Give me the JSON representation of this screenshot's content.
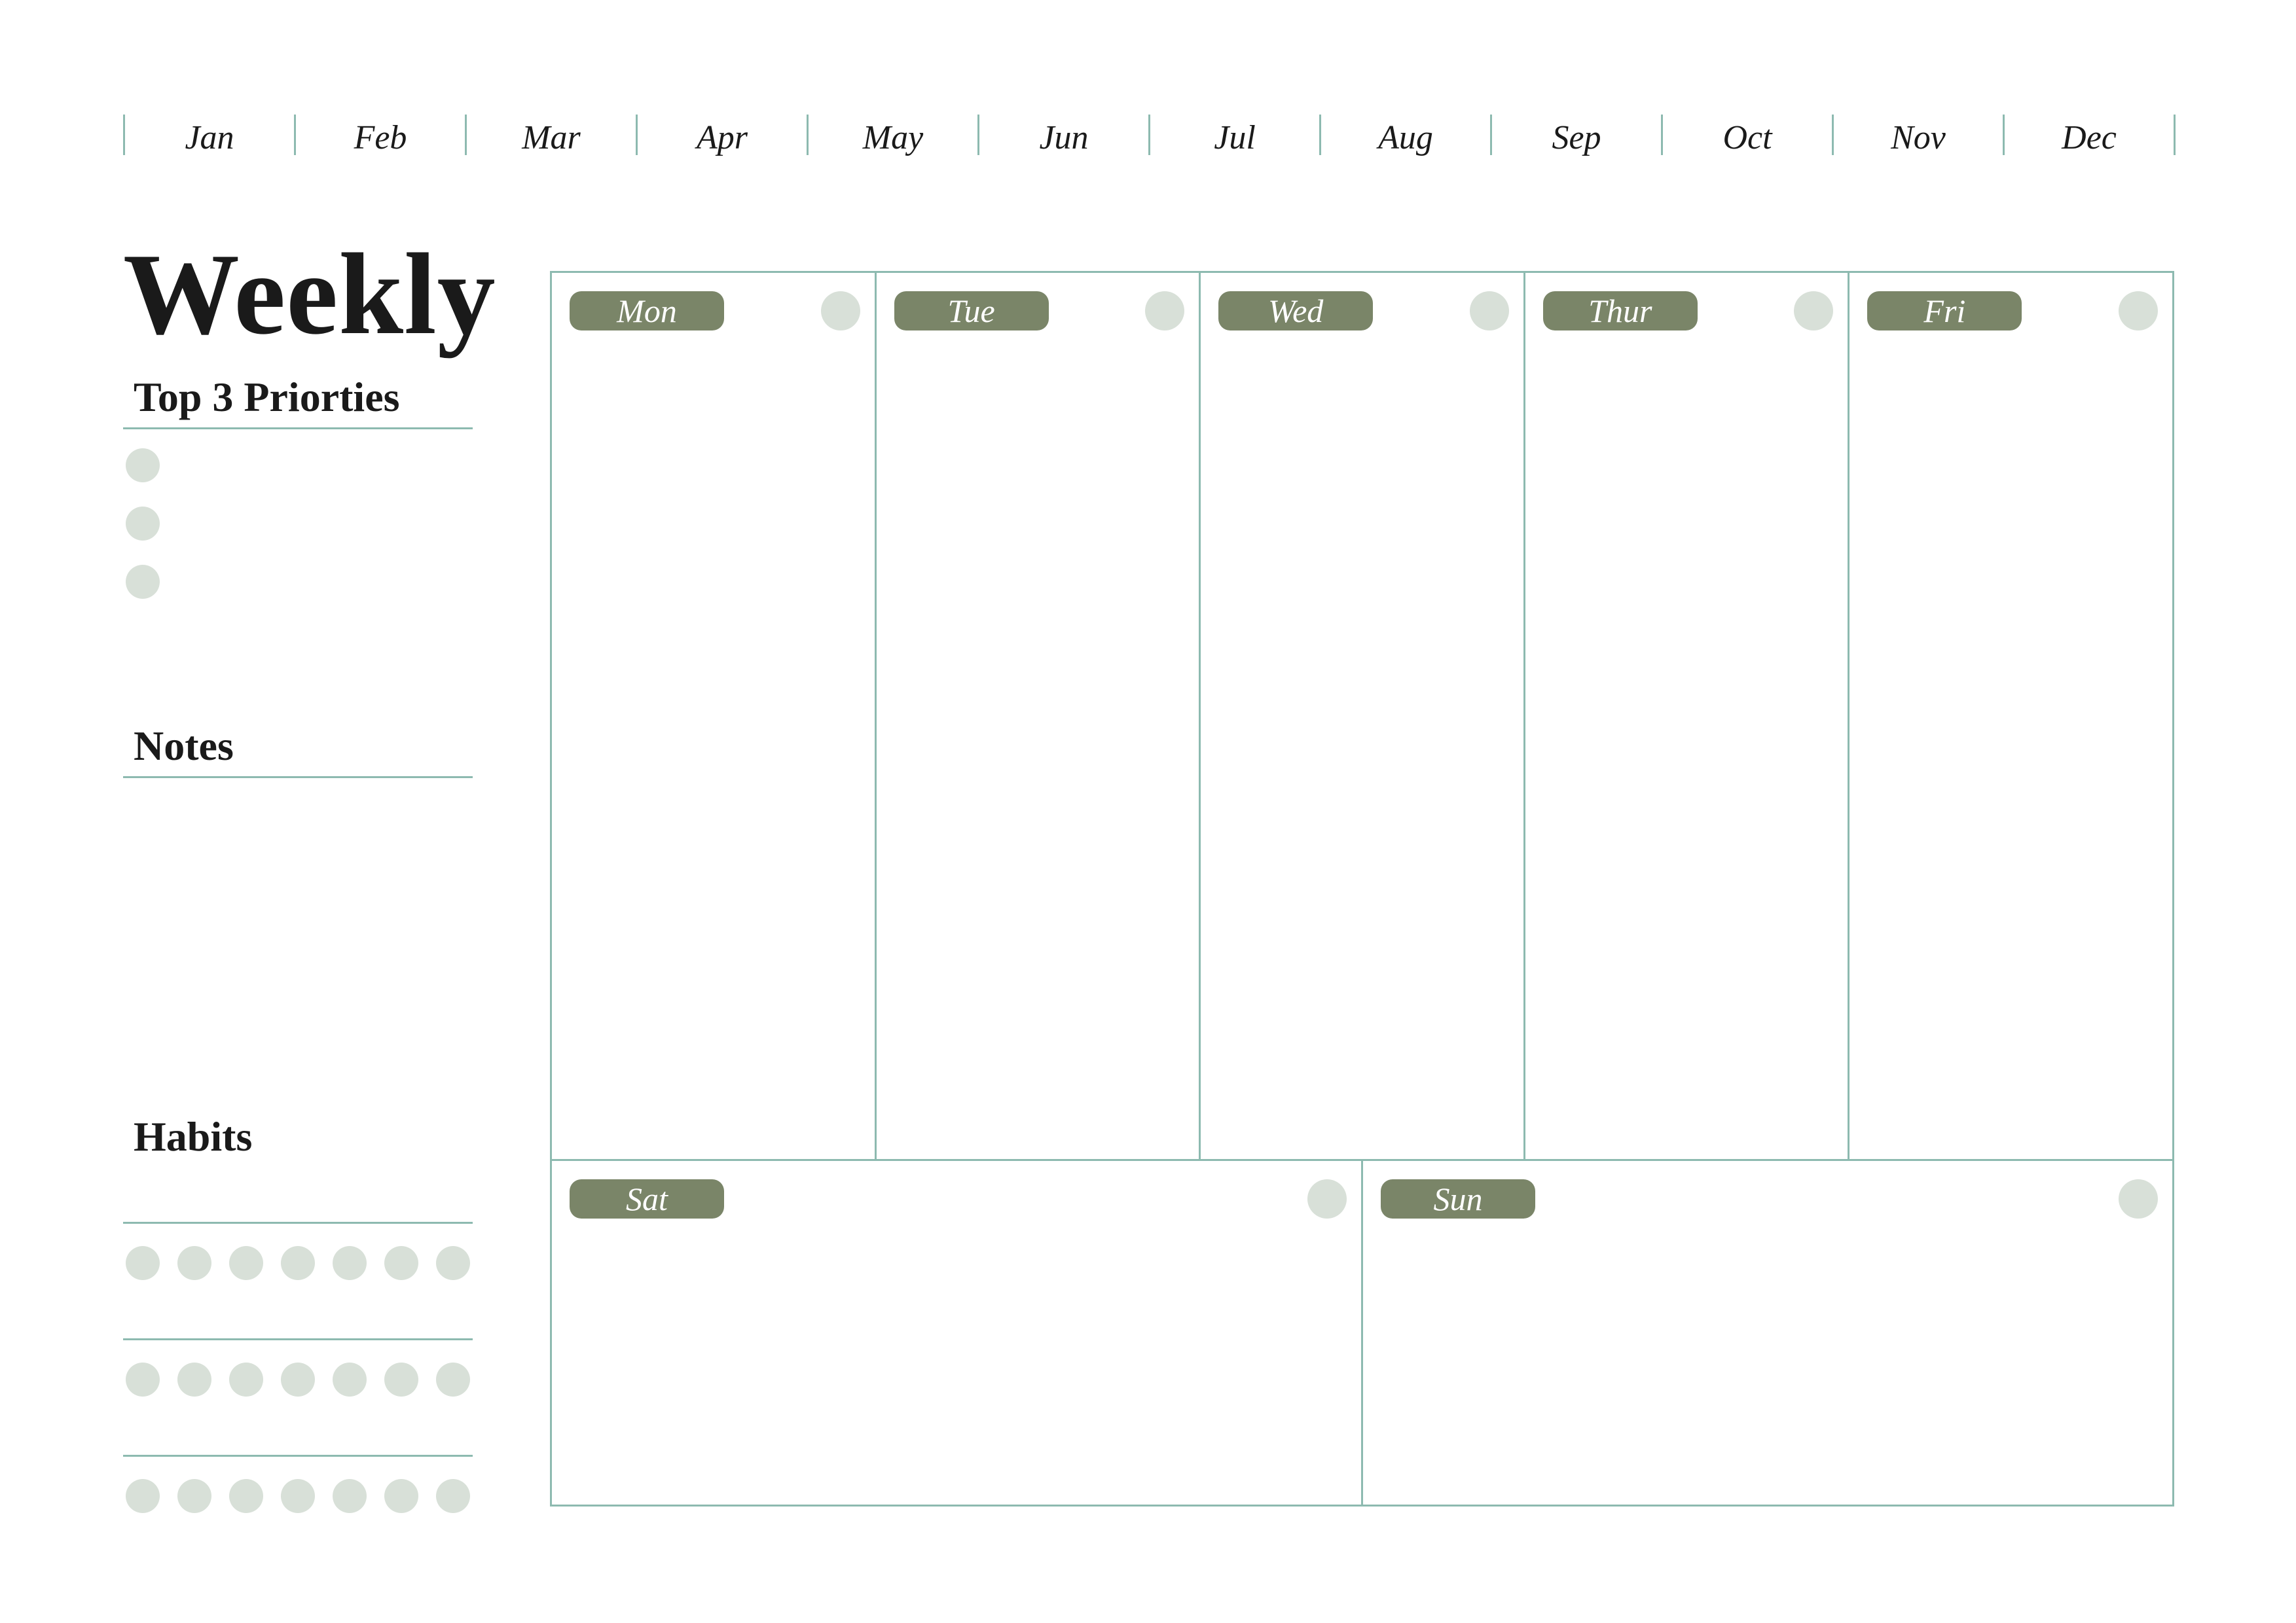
{
  "months": [
    "Jan",
    "Feb",
    "Mar",
    "Apr",
    "May",
    "Jun",
    "Jul",
    "Aug",
    "Sep",
    "Oct",
    "Nov",
    "Dec"
  ],
  "sidebar": {
    "title": "Weekly",
    "priorities_heading": "Top 3 Priorties",
    "notes_heading": "Notes",
    "habits_heading": "Habits"
  },
  "days": {
    "mon": "Mon",
    "tue": "Tue",
    "wed": "Wed",
    "thu": "Thur",
    "fri": "Fri",
    "sat": "Sat",
    "sun": "Sun"
  },
  "colors": {
    "accent_line": "#8dbab0",
    "pill": "#7a8568",
    "dot": "#d8e0d8"
  }
}
